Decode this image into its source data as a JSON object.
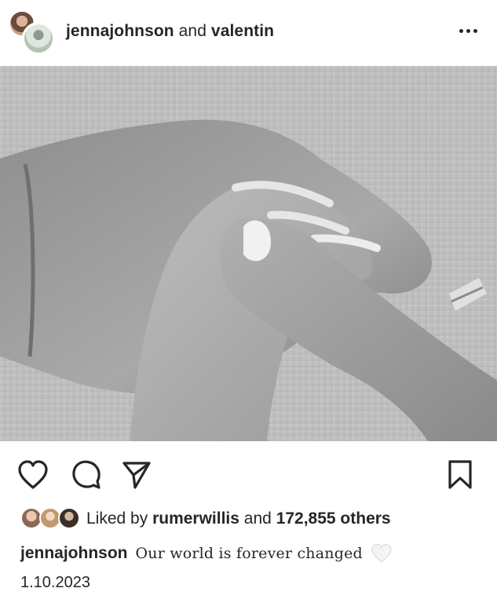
{
  "post": {
    "header": {
      "username": "jennajohnson",
      "conjunction": "and",
      "collaborator": "valentin"
    },
    "actions": {
      "like_icon": "heart-outline-icon",
      "comment_icon": "comment-icon",
      "share_icon": "paper-plane-icon",
      "save_icon": "bookmark-icon"
    },
    "likes": {
      "prefix": "Liked by",
      "liker": "rumerwillis",
      "middle": "and",
      "count_text": "172,855 others"
    },
    "caption": {
      "username": "jennajohnson",
      "text": "Our world is forever changed",
      "emoji": "white-heart-icon"
    },
    "date": "1.10.2023"
  }
}
